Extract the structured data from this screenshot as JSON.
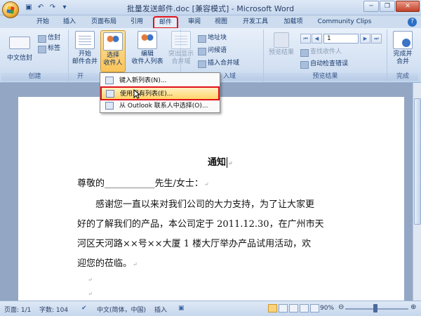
{
  "window": {
    "title": "批量发送邮件.doc [兼容模式] - Microsoft Word",
    "minimize_glyph": "─",
    "maximize_glyph": "❐",
    "close_glyph": "✕"
  },
  "quick_access": [
    "save-icon",
    "undo-icon",
    "redo-icon",
    "customize-icon"
  ],
  "tabs": [
    "开始",
    "插入",
    "页面布局",
    "引用",
    "邮件",
    "审阅",
    "视图",
    "开发工具",
    "加载项",
    "Community Clips"
  ],
  "active_tab": "邮件",
  "ribbon": {
    "create": {
      "label": "创建",
      "chinese_envelope": "中文信封",
      "envelope": "信封",
      "labels": "标签"
    },
    "start_merge": {
      "label": "开",
      "start_line1": "开始",
      "start_line2": "邮件合并",
      "select_line1": "选择",
      "select_line2": "收件人",
      "edit_line1": "编辑",
      "edit_line2": "收件人列表"
    },
    "fields": {
      "label": "入域",
      "highlight_line1": "突出显示",
      "highlight_line2": "合并域",
      "address_block": "地址块",
      "greeting_line": "问候语",
      "insert_merge_field": "插入合并域"
    },
    "preview": {
      "label": "预览结果",
      "preview_results": "预览结果",
      "record_value": "1",
      "find_recipient": "查找收件人",
      "auto_check": "自动检查错误"
    },
    "finish": {
      "label": "完成",
      "finish_line1": "完成并",
      "finish_line2": "合并"
    }
  },
  "dropdown": {
    "items": [
      {
        "label": "键入新列表(N)...",
        "icon": "new-list-icon"
      },
      {
        "label": "使用现有列表(E)...",
        "icon": "existing-list-icon"
      },
      {
        "label": "从 Outlook 联系人中选择(O)...",
        "icon": "outlook-contacts-icon"
      }
    ]
  },
  "document": {
    "heading": "通知",
    "salutation": "尊敬的___________先生/女士：",
    "body_lines": [
      "感谢您一直以来对我们公司的大力支持，为了让大家更",
      "好的了解我们的产品，本公司定于  2011.12.30，在广州市天",
      "河区天河路××号××大厦 1 楼大厅举办产品试用活动，欢",
      "迎您的莅临。"
    ],
    "paragraph_mark": "↵"
  },
  "status": {
    "page": "页面: 1/1",
    "words": "字数: 104",
    "language": "中文(简体，中国)",
    "mode": "插入",
    "zoom": "90%"
  }
}
